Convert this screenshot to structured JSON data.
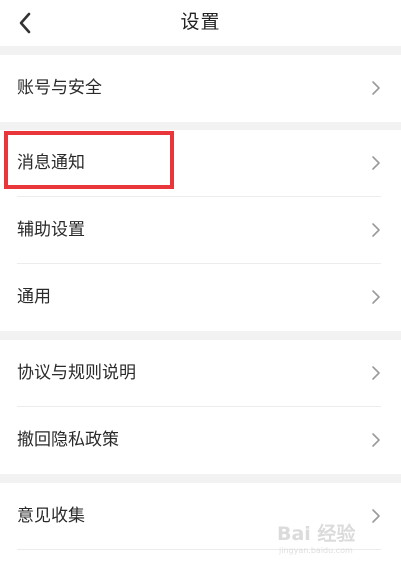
{
  "header": {
    "title": "设置",
    "back_icon": "chevron-left-icon"
  },
  "groups": [
    {
      "items": [
        {
          "label": "账号与安全",
          "icon": "chevron-right-icon"
        }
      ]
    },
    {
      "items": [
        {
          "label": "消息通知",
          "icon": "chevron-right-icon",
          "highlighted": true
        },
        {
          "label": "辅助设置",
          "icon": "chevron-right-icon"
        },
        {
          "label": "通用",
          "icon": "chevron-right-icon"
        }
      ]
    },
    {
      "items": [
        {
          "label": "协议与规则说明",
          "icon": "chevron-right-icon"
        },
        {
          "label": "撤回隐私政策",
          "icon": "chevron-right-icon"
        }
      ]
    },
    {
      "items": [
        {
          "label": "意见收集",
          "icon": "chevron-right-icon"
        }
      ]
    }
  ],
  "annotation": {
    "color": "#e8363a"
  },
  "watermark": {
    "brand": "Bai 经验",
    "url": "jingyan.baidu.com"
  }
}
